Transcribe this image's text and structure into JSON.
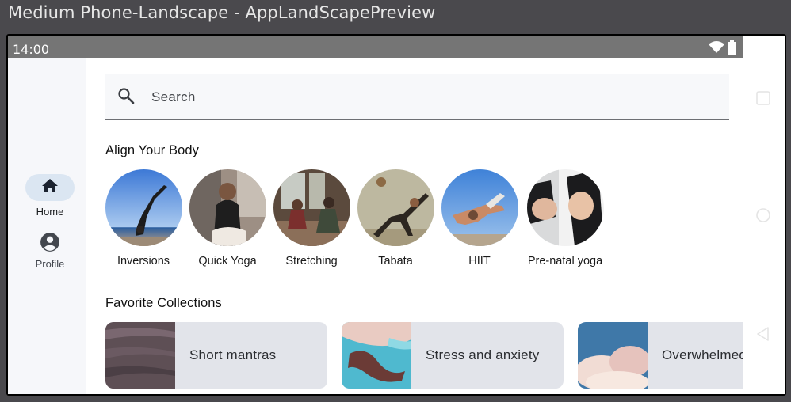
{
  "window": {
    "title": "Medium Phone-Landscape - AppLandScapePreview"
  },
  "statusbar": {
    "time": "14:00",
    "icons": [
      "wifi-icon",
      "battery-icon"
    ]
  },
  "rail": {
    "items": [
      {
        "label": "Home",
        "icon": "home-icon",
        "selected": true
      },
      {
        "label": "Profile",
        "icon": "account-icon",
        "selected": false
      }
    ]
  },
  "search": {
    "placeholder": "Search",
    "icon": "search-icon"
  },
  "align": {
    "title": "Align Your Body",
    "items": [
      {
        "label": "Inversions"
      },
      {
        "label": "Quick Yoga"
      },
      {
        "label": "Stretching"
      },
      {
        "label": "Tabata"
      },
      {
        "label": "HIIT"
      },
      {
        "label": "Pre-natal yoga"
      }
    ]
  },
  "favorites": {
    "title": "Favorite Collections",
    "items": [
      {
        "label": "Short mantras"
      },
      {
        "label": "Stress and anxiety"
      },
      {
        "label": "Overwhelmed"
      }
    ]
  },
  "navbar": {
    "buttons": [
      "recents-button",
      "home-button",
      "back-button"
    ]
  },
  "colors": {
    "rail_active": "#dbe6f2",
    "card_bg": "#e2e4ea",
    "statusbar": "#757575"
  }
}
